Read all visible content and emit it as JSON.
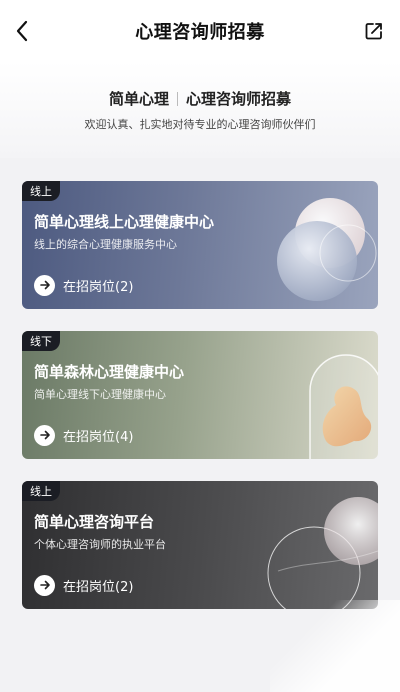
{
  "navbar": {
    "title": "心理咨询师招募",
    "back_icon": "chevron-left-icon",
    "share_icon": "share-icon"
  },
  "hero": {
    "brand": "简单心理",
    "title": "心理咨询师招募",
    "subtitle": "欢迎认真、扎实地对待专业的心理咨询师伙伴们"
  },
  "cards": [
    {
      "tag": "线上",
      "title": "简单心理线上心理健康中心",
      "subtitle": "线上的综合心理健康服务中心",
      "action": "在招岗位(2)",
      "color_start": "#4d5a80",
      "color_end": "#9aa4bd"
    },
    {
      "tag": "线下",
      "title": "简单森林心理健康中心",
      "subtitle": "简单心理线下心理健康中心",
      "action": "在招岗位(4)",
      "color_start": "#6b7a66",
      "color_end": "#dbdbcc"
    },
    {
      "tag": "线上",
      "title": "简单心理咨询平台",
      "subtitle": "个体心理咨询师的执业平台",
      "action": "在招岗位(2)",
      "color_start": "#2f2f31",
      "color_end": "#6a6a6c"
    }
  ]
}
